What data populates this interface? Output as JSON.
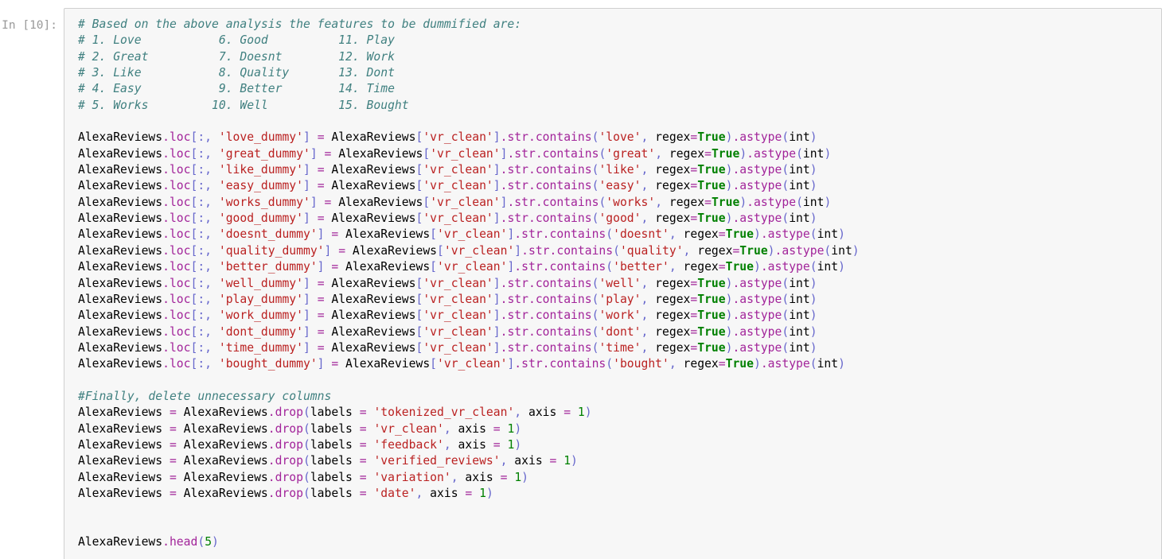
{
  "notebook": {
    "prompt_label": "In [10]:",
    "cell_type": "code",
    "colors": {
      "page_background": "#ffffff",
      "cell_background": "#f7f7f7",
      "cell_border": "#cfcfcf",
      "prompt_text": "#999999",
      "comment": "#408080",
      "string": "#ba2121",
      "keyword": "#008000",
      "number": "#008000",
      "operator": "#a2249a",
      "punctuation": "#6666cc",
      "name": "#000000"
    },
    "comment_header": "# Based on the above analysis the features to be dummified are:",
    "comment_list_lines": [
      "# 1. Love           6. Good          11. Play",
      "# 2. Great          7. Doesnt        12. Work",
      "# 3. Like           8. Quality       13. Dont",
      "# 4. Easy           9. Better        14. Time",
      "# 5. Works         10. Well          15. Bought"
    ],
    "feature_list": [
      {
        "n": "1.",
        "word": "Love"
      },
      {
        "n": "2.",
        "word": "Great"
      },
      {
        "n": "3.",
        "word": "Like"
      },
      {
        "n": "4.",
        "word": "Easy"
      },
      {
        "n": "5.",
        "word": "Works"
      },
      {
        "n": "6.",
        "word": "Good"
      },
      {
        "n": "7.",
        "word": "Doesnt"
      },
      {
        "n": "8.",
        "word": "Quality"
      },
      {
        "n": "9.",
        "word": "Better"
      },
      {
        "n": "10.",
        "word": "Well"
      },
      {
        "n": "11.",
        "word": "Play"
      },
      {
        "n": "12.",
        "word": "Work"
      },
      {
        "n": "13.",
        "word": "Dont"
      },
      {
        "n": "14.",
        "word": "Time"
      },
      {
        "n": "15.",
        "word": "Bought"
      }
    ],
    "dummy_statements": [
      {
        "dummy_col": "'love_dummy'",
        "source_col": "'vr_clean'",
        "pattern": "'love'"
      },
      {
        "dummy_col": "'great_dummy'",
        "source_col": "'vr_clean'",
        "pattern": "'great'"
      },
      {
        "dummy_col": "'like_dummy'",
        "source_col": "'vr_clean'",
        "pattern": "'like'"
      },
      {
        "dummy_col": "'easy_dummy'",
        "source_col": "'vr_clean'",
        "pattern": "'easy'"
      },
      {
        "dummy_col": "'works_dummy'",
        "source_col": "'vr_clean'",
        "pattern": "'works'"
      },
      {
        "dummy_col": "'good_dummy'",
        "source_col": "'vr_clean'",
        "pattern": "'good'"
      },
      {
        "dummy_col": "'doesnt_dummy'",
        "source_col": "'vr_clean'",
        "pattern": "'doesnt'"
      },
      {
        "dummy_col": "'quality_dummy'",
        "source_col": "'vr_clean'",
        "pattern": "'quality'"
      },
      {
        "dummy_col": "'better_dummy'",
        "source_col": "'vr_clean'",
        "pattern": "'better'"
      },
      {
        "dummy_col": "'well_dummy'",
        "source_col": "'vr_clean'",
        "pattern": "'well'"
      },
      {
        "dummy_col": "'play_dummy'",
        "source_col": "'vr_clean'",
        "pattern": "'play'"
      },
      {
        "dummy_col": "'work_dummy'",
        "source_col": "'vr_clean'",
        "pattern": "'work'"
      },
      {
        "dummy_col": "'dont_dummy'",
        "source_col": "'vr_clean'",
        "pattern": "'dont'"
      },
      {
        "dummy_col": "'time_dummy'",
        "source_col": "'vr_clean'",
        "pattern": "'time'"
      },
      {
        "dummy_col": "'bought_dummy'",
        "source_col": "'vr_clean'",
        "pattern": "'bought'"
      }
    ],
    "dummy_tokens": {
      "df": "AlexaReviews",
      "loc": ".loc",
      "open_bracket": "[",
      "colon_comma": ":,",
      "space": " ",
      "close_bracket": "]",
      "assign": "=",
      "str_accessor": ".str",
      "contains": ".contains",
      "open_paren": "(",
      "close_paren": ")",
      "comma": ",",
      "regex_kw": "regex",
      "regex_value": "True",
      "astype": ".astype",
      "int_type": "int"
    },
    "drop_comment": "#Finally, delete unnecessary columns",
    "drop_statements": [
      {
        "label": "'tokenized_vr_clean'",
        "axis": "1"
      },
      {
        "label": "'vr_clean'",
        "axis": "1"
      },
      {
        "label": "'feedback'",
        "axis": "1"
      },
      {
        "label": "'verified_reviews'",
        "axis": "1"
      },
      {
        "label": "'variation'",
        "axis": "1"
      },
      {
        "label": "'date'",
        "axis": "1"
      }
    ],
    "drop_tokens": {
      "df": "AlexaReviews",
      "assign": "=",
      "drop": ".drop",
      "open_paren": "(",
      "labels_kw": "labels",
      "eq": "=",
      "comma": ",",
      "axis_kw": "axis",
      "close_paren": ")"
    },
    "tail_statement": {
      "df": "AlexaReviews",
      "head": ".head",
      "open_paren": "(",
      "arg": "5",
      "close_paren": ")"
    }
  }
}
